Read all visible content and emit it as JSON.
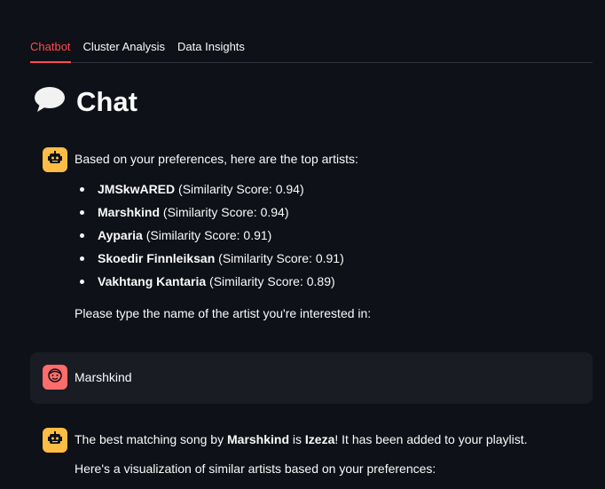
{
  "tabs": [
    {
      "label": "Chatbot",
      "active": true
    },
    {
      "label": "Cluster Analysis",
      "active": false
    },
    {
      "label": "Data Insights",
      "active": false
    }
  ],
  "title": {
    "icon": "speech-balloon-icon",
    "text": "Chat"
  },
  "colors": {
    "accent": "#ff4b4b",
    "bot_avatar": "#ffbd45",
    "user_avatar": "#ff6c6c",
    "background": "#0e1117",
    "user_message_bg": "#1a1c24"
  },
  "messages": [
    {
      "role": "assistant",
      "avatar_icon": "robot-icon",
      "intro": "Based on your preferences, here are the top artists:",
      "artists": [
        {
          "name": "JMSkwARED",
          "score_text": " (Similarity Score: 0.94)"
        },
        {
          "name": "Marshkind",
          "score_text": " (Similarity Score: 0.94)"
        },
        {
          "name": "Ayparia",
          "score_text": " (Similarity Score: 0.91)"
        },
        {
          "name": "Skoedir Finnleiksan",
          "score_text": " (Similarity Score: 0.91)"
        },
        {
          "name": "Vakhtang Kantaria",
          "score_text": " (Similarity Score: 0.89)"
        }
      ],
      "prompt": "Please type the name of the artist you're interested in:"
    },
    {
      "role": "user",
      "avatar_icon": "smiley-face-icon",
      "text": "Marshkind"
    },
    {
      "role": "assistant",
      "avatar_icon": "robot-icon",
      "p1_prefix": "The best matching song by ",
      "p1_artist": "Marshkind",
      "p1_middle": " is ",
      "p1_song": "Izeza",
      "p1_suffix": "! It has been added to your playlist.",
      "p2": "Here's a visualization of similar artists based on your preferences:"
    }
  ]
}
